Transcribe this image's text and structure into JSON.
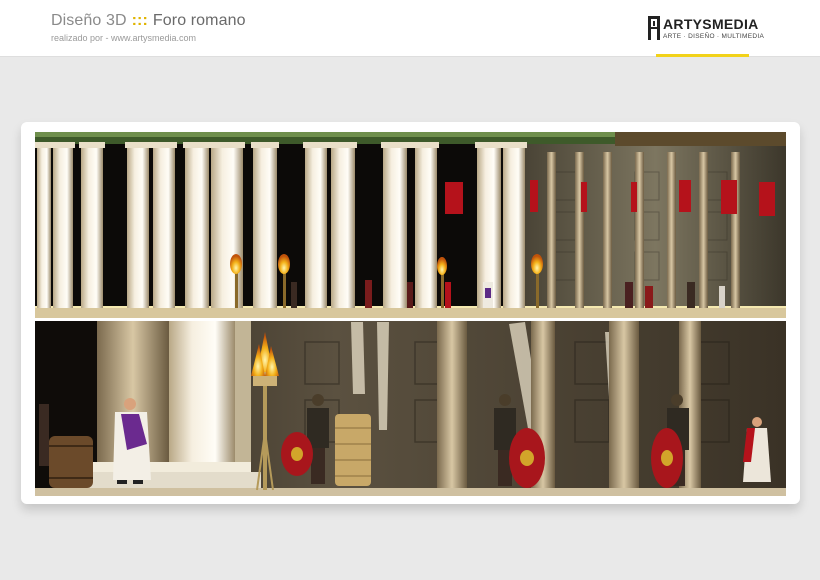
{
  "header": {
    "title": "Diseño 3D",
    "separator": ":::",
    "project": "Foro romano",
    "subtitle": "realizado por - www.artysmedia.com"
  },
  "logo": {
    "name": "ARTYSMEDIA",
    "tagline": "ARTE · DISEÑO · MULTIMEDIA",
    "accent": "#f2d21a"
  },
  "colors": {
    "background": "#e9e9e9",
    "accent": "#e0b400",
    "banner_red": "#b5121b"
  }
}
